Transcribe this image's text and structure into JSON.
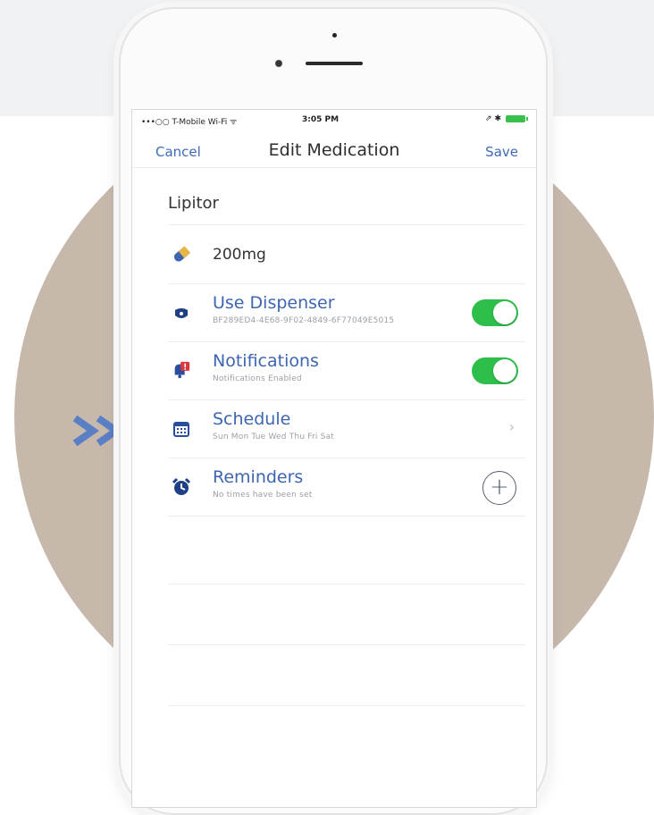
{
  "status_bar": {
    "carrier": "•••○○ T-Mobile Wi-Fi ᯤ",
    "time": "3:05 PM",
    "right_icons": "⇗ ✱"
  },
  "nav": {
    "cancel_label": "Cancel",
    "title": "Edit Medication",
    "save_label": "Save"
  },
  "medication": {
    "name": "Lipitor",
    "dose": "200mg"
  },
  "rows": {
    "dispenser": {
      "title": "Use Dispenser",
      "subtitle": "BF289ED4-4E68-9F02-4849-6F77049E5015",
      "enabled": true,
      "icon": "dispenser-icon"
    },
    "notifications": {
      "title": "Notifications",
      "subtitle": "Notifications Enabled",
      "enabled": true,
      "icon": "bell-alert-icon"
    },
    "schedule": {
      "title": "Schedule",
      "subtitle": "Sun Mon Tue Wed Thu Fri Sat",
      "chevron": "›",
      "icon": "calendar-icon"
    },
    "reminders": {
      "title": "Reminders",
      "subtitle": "No times have been set",
      "add_symbol": "+",
      "icon": "alarm-clock-icon"
    }
  },
  "colors": {
    "accent": "#3f6bb5",
    "toggle_on": "#2dbf4a",
    "backdrop_circle": "#c7b8ac",
    "arrow_marker": "#5b7fc4"
  }
}
